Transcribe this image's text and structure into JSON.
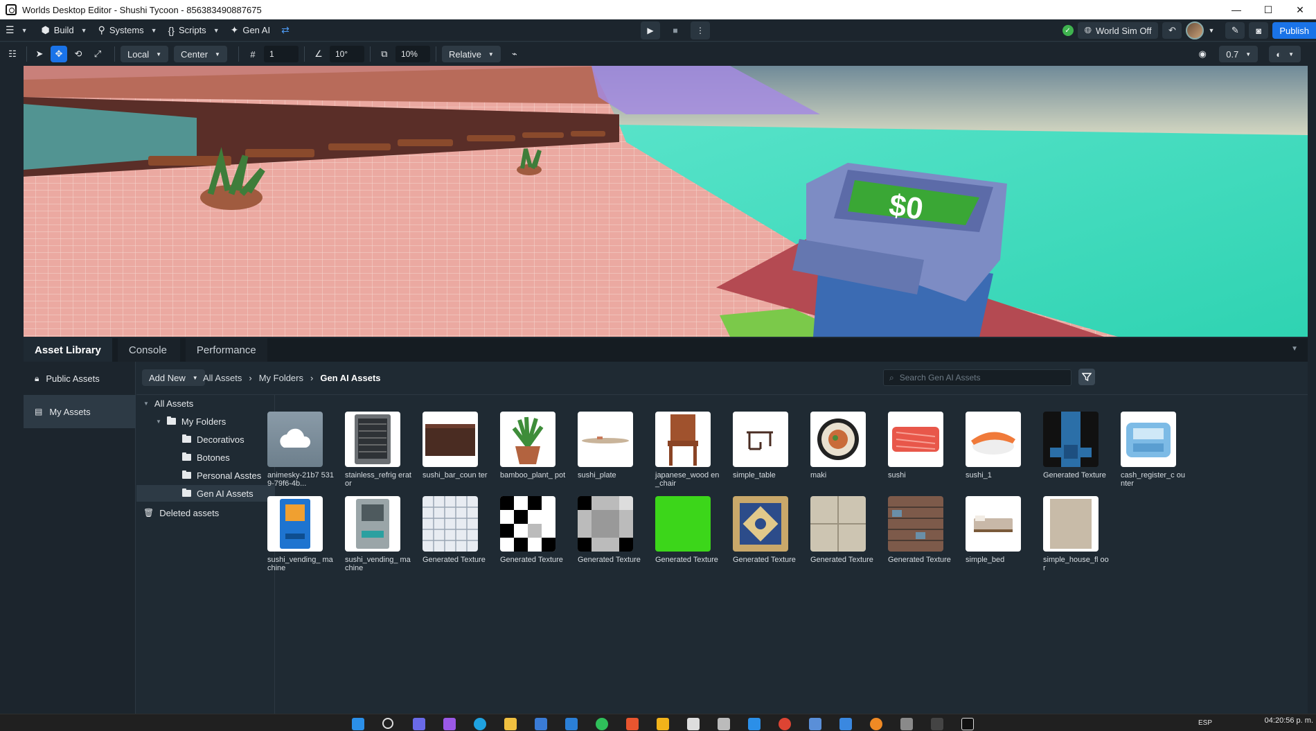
{
  "window": {
    "title": "Worlds Desktop Editor - Shushi Tycoon - 856383490887675",
    "controls": [
      "—",
      "☐",
      "✕"
    ]
  },
  "toolbar": {
    "menus": [
      {
        "label": "Build",
        "icon": "cube-icon"
      },
      {
        "label": "Systems",
        "icon": "systems-icon"
      },
      {
        "label": "Scripts",
        "icon": "braces-icon"
      },
      {
        "label": "Gen AI",
        "icon": "sparkle-icon"
      }
    ],
    "world_sim_label": "World Sim Off",
    "publish_label": "Publish"
  },
  "toolbar2": {
    "space": "Local",
    "pivot": "Center",
    "grid_snap": "1",
    "rotation_snap": "10°",
    "scale_snap": "10%",
    "mode": "Relative",
    "camera_speed": "0.7"
  },
  "viewport": {
    "register_display": "$0"
  },
  "panel": {
    "tabs": [
      "Asset Library",
      "Console",
      "Performance"
    ],
    "nav": {
      "public": "Public Assets",
      "mine": "My Assets"
    },
    "add_new": "Add New",
    "breadcrumb": [
      "All Assets",
      "My Folders",
      "Gen AI Assets"
    ],
    "search_placeholder": "Search Gen AI Assets",
    "tree": {
      "all": "All Assets",
      "my_folders": "My Folders",
      "folders": [
        "Decorativos",
        "Botones",
        "Personal Asstes",
        "Gen AI Assets"
      ],
      "deleted": "Deleted assets"
    }
  },
  "assets": [
    {
      "name": "animesky-21b7 5319-79f6-4b..."
    },
    {
      "name": "stainless_refrig erator"
    },
    {
      "name": "sushi_bar_coun ter"
    },
    {
      "name": "bamboo_plant_ pot"
    },
    {
      "name": "sushi_plate"
    },
    {
      "name": "japanese_wood en_chair"
    },
    {
      "name": "simple_table"
    },
    {
      "name": "maki"
    },
    {
      "name": "sushi"
    },
    {
      "name": "sushi_1"
    },
    {
      "name": "Generated Texture"
    },
    {
      "name": "cash_register_c ounter"
    },
    {
      "name": "sushi_vending_ machine"
    },
    {
      "name": "sushi_vending_ machine"
    },
    {
      "name": "Generated Texture"
    },
    {
      "name": "Generated Texture"
    },
    {
      "name": "Generated Texture"
    },
    {
      "name": "Generated Texture"
    },
    {
      "name": "Generated Texture"
    },
    {
      "name": "Generated Texture"
    },
    {
      "name": "Generated Texture"
    },
    {
      "name": "simple_bed"
    },
    {
      "name": "simple_house_fl oor"
    }
  ],
  "taskbar": {
    "lang": "ESP",
    "clock": "04:20:56 p. m."
  },
  "colors": {
    "accent": "#1a73e8",
    "panel_bg": "#1f2a33",
    "status_ok": "#3fb34f"
  }
}
